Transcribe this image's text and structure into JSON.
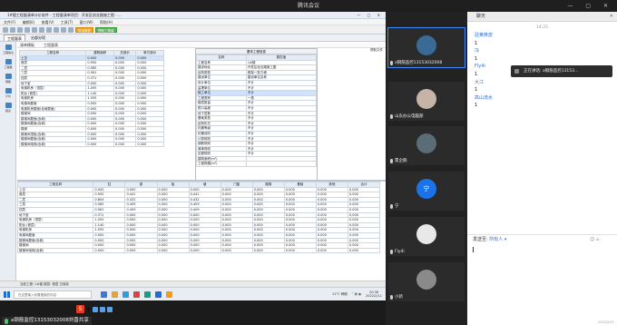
{
  "window_title": "腾讯会议",
  "shared": {
    "app_title": "1#楼工程量清单计价软件 - 工程量清单项目：开发区创业路施工图 - ...",
    "menu": [
      "文件(F)",
      "编辑(E)",
      "查看(V)",
      "工具(T)",
      "窗口(W)",
      "帮助(H)"
    ],
    "toolbar_green": "提取工程量",
    "toolbar_orange": "导出报表",
    "tabs": [
      "工程量表",
      "分部分项"
    ],
    "nav": [
      "工程信息",
      "工程量",
      "钢筋",
      "计价",
      "报表"
    ],
    "content_tabs": [
      "清单模板",
      "工程量表"
    ],
    "table1": {
      "headers": [
        "工程名称",
        "建筑面积",
        "总造价",
        "单方造价"
      ],
      "rows": [
        [
          "上空",
          "0.000",
          "0.000",
          "0.000"
        ],
        [
          "首层",
          "0.950",
          "0.000",
          "0.000"
        ],
        [
          "二层",
          "0.585",
          "0.000",
          "0.000"
        ],
        [
          "三层",
          "0.561",
          "0.000",
          "0.000"
        ],
        [
          "四层",
          "0.371",
          "0.000",
          "0.000"
        ],
        [
          "地下室",
          "0.000",
          "0.000",
          "0.000"
        ],
        [
          "电梯机房（顶层）",
          "1.055",
          "0.000",
          "0.000"
        ],
        [
          "阳台 (首层)",
          "1.140",
          "0.000",
          "0.000"
        ],
        [
          "电梯机房",
          "1.055",
          "0.000",
          "0.000"
        ],
        [
          "电梯间屋面",
          "0.000",
          "0.000",
          "0.000"
        ],
        [
          "电梯机房屋面(含坡屋面)",
          "0.000",
          "0.000",
          "0.000"
        ],
        [
          "楼梯间",
          "0.000",
          "0.000",
          "0.000"
        ],
        [
          "楼梯间屋面(含坡)",
          "0.000",
          "0.000",
          "0.000"
        ],
        [
          "楼梯间屋面(含坡)",
          "0.000",
          "0.000",
          "0.000"
        ],
        [
          "楼梯",
          "0.000",
          "0.000",
          "0.000"
        ],
        [
          "楼梯间顶板(含坡)",
          "0.000",
          "0.000",
          "0.000"
        ],
        [
          "楼梯间屋面(含坡)",
          "0.000",
          "0.000",
          "0.000"
        ],
        [
          "楼梯间电梯(含坡)",
          "0.000",
          "0.000",
          "0.000"
        ]
      ]
    },
    "props": {
      "title": "基本工程信息",
      "headers": [
        "名称",
        "属性值"
      ],
      "rows": [
        [
          "工程名称",
          "1#楼"
        ],
        [
          "建设地址",
          "开发区创业路施工图"
        ],
        [
          "结构类型",
          "框架一剪力墙"
        ],
        [
          "建设单位",
          "建设单位名称"
        ],
        [
          "设计单位",
          "不计"
        ],
        [
          "监理单位",
          "不计"
        ],
        [
          "施工单位",
          "不计"
        ],
        [
          "工程类别",
          "一类"
        ],
        [
          "楼层数量",
          "不计"
        ],
        [
          "檐口高度",
          "不计"
        ],
        [
          "地下层数",
          "不计"
        ],
        [
          "基础类型",
          "不计"
        ],
        [
          "结构形式",
          "不计"
        ],
        [
          "抗震等级",
          "不计"
        ],
        [
          "抗震设防",
          "不计"
        ],
        [
          "计算规则",
          "不计"
        ],
        [
          "钢筋规则",
          "不计"
        ],
        [
          "清单规则",
          "不计"
        ],
        [
          "定额规则",
          "不计"
        ],
        [
          "建筑面积(m²)",
          ""
        ],
        [
          "工程规模(m²)",
          ""
        ]
      ]
    },
    "right_tag": "提取文件",
    "lower": {
      "headers": [
        "工程名称",
        "柱",
        "梁",
        "板",
        "墙",
        "门窗",
        "楼梯",
        "基础",
        "其他",
        "合计"
      ],
      "rows": [
        [
          "上空",
          "0.000",
          "0.000",
          "0.000",
          "0.000",
          "0.000",
          "0.000",
          "0.000",
          "0.000",
          "0.000"
        ],
        [
          "首层",
          "0.950",
          "0.441",
          "0.000",
          "0.441",
          "0.000",
          "0.000",
          "0.000",
          "0.000",
          "0.000"
        ],
        [
          "二层",
          "0.804",
          "0.432",
          "0.000",
          "0.432",
          "0.000",
          "0.000",
          "0.000",
          "0.000",
          "0.000"
        ],
        [
          "三层",
          "0.585",
          "0.409",
          "0.000",
          "0.409",
          "0.000",
          "0.000",
          "0.000",
          "0.000",
          "0.000"
        ],
        [
          "四层",
          "0.561",
          "0.409",
          "0.000",
          "0.409",
          "0.000",
          "0.000",
          "0.000",
          "0.000",
          "0.000"
        ],
        [
          "地下室",
          "0.371",
          "0.000",
          "0.000",
          "0.000",
          "0.000",
          "0.000",
          "0.000",
          "0.000",
          "0.000"
        ],
        [
          "电梯机房（顶层）",
          "1.055",
          "0.000",
          "0.000",
          "0.000",
          "0.000",
          "0.000",
          "0.000",
          "0.000",
          "0.000"
        ],
        [
          "阳台 (首层)",
          "1.140",
          "0.000",
          "0.000",
          "0.000",
          "0.000",
          "0.000",
          "0.000",
          "0.000",
          "0.000"
        ],
        [
          "电梯机房",
          "1.055",
          "0.000",
          "0.000",
          "0.000",
          "0.000",
          "0.000",
          "0.000",
          "0.000",
          "0.000"
        ],
        [
          "电梯间屋面",
          "0.000",
          "0.000",
          "0.000",
          "0.000",
          "0.000",
          "0.000",
          "0.000",
          "0.000",
          "0.000"
        ],
        [
          "楼梯间屋面(含坡)",
          "0.000",
          "0.000",
          "0.000",
          "0.000",
          "0.000",
          "0.000",
          "0.000",
          "0.000",
          "0.000"
        ],
        [
          "楼梯间",
          "0.000",
          "0.000",
          "0.000",
          "0.000",
          "0.000",
          "0.000",
          "0.000",
          "0.000",
          "0.000"
        ],
        [
          "楼梯间电梯(含坡)",
          "0.000",
          "0.000",
          "0.000",
          "0.000",
          "0.000",
          "0.000",
          "0.000",
          "0.000",
          "0.000"
        ]
      ]
    },
    "status_text": "当前工程: 1#楼    楼层: 首层    已保存",
    "taskbar": {
      "search_placeholder": "在这里输入你要搜索的内容",
      "weather": "11°C 晴朗",
      "time": "20:38",
      "date": "2022/2/11"
    }
  },
  "speaking_bar": "a钢筋监控13153032008刘晋共享",
  "participants": [
    {
      "name": "a钢筋监控13153032008",
      "color": "#3a6b96",
      "initial": ""
    },
    {
      "name": "山东办公电脑部",
      "color": "#c7b4a8",
      "initial": ""
    },
    {
      "name": "累企鹅",
      "color": "#5a6c78",
      "initial": ""
    },
    {
      "name": "宁",
      "color": "#1a73e8",
      "initial": "宁"
    },
    {
      "name": "Fly4i",
      "color": "#e8e8e8",
      "initial": ""
    },
    {
      "name": "小新",
      "color": "#8a8a8a",
      "initial": ""
    }
  ],
  "chat": {
    "title": "聊天",
    "time": "14:25",
    "messages": [
      {
        "sender": "驻莱蔗皮",
        "body": "1"
      },
      {
        "sender": "冯",
        "body": "1"
      },
      {
        "sender": "Fly4i",
        "body": "1"
      },
      {
        "sender": "大江",
        "body": "1"
      },
      {
        "sender": "高山流水",
        "body": "1"
      }
    ],
    "speaking_popup": "正在讲话: a钢筋监控13153...",
    "send_to_label": "发送至:",
    "send_to_value": "所有人",
    "ime_label": "中",
    "corner": "2022/2/11"
  }
}
